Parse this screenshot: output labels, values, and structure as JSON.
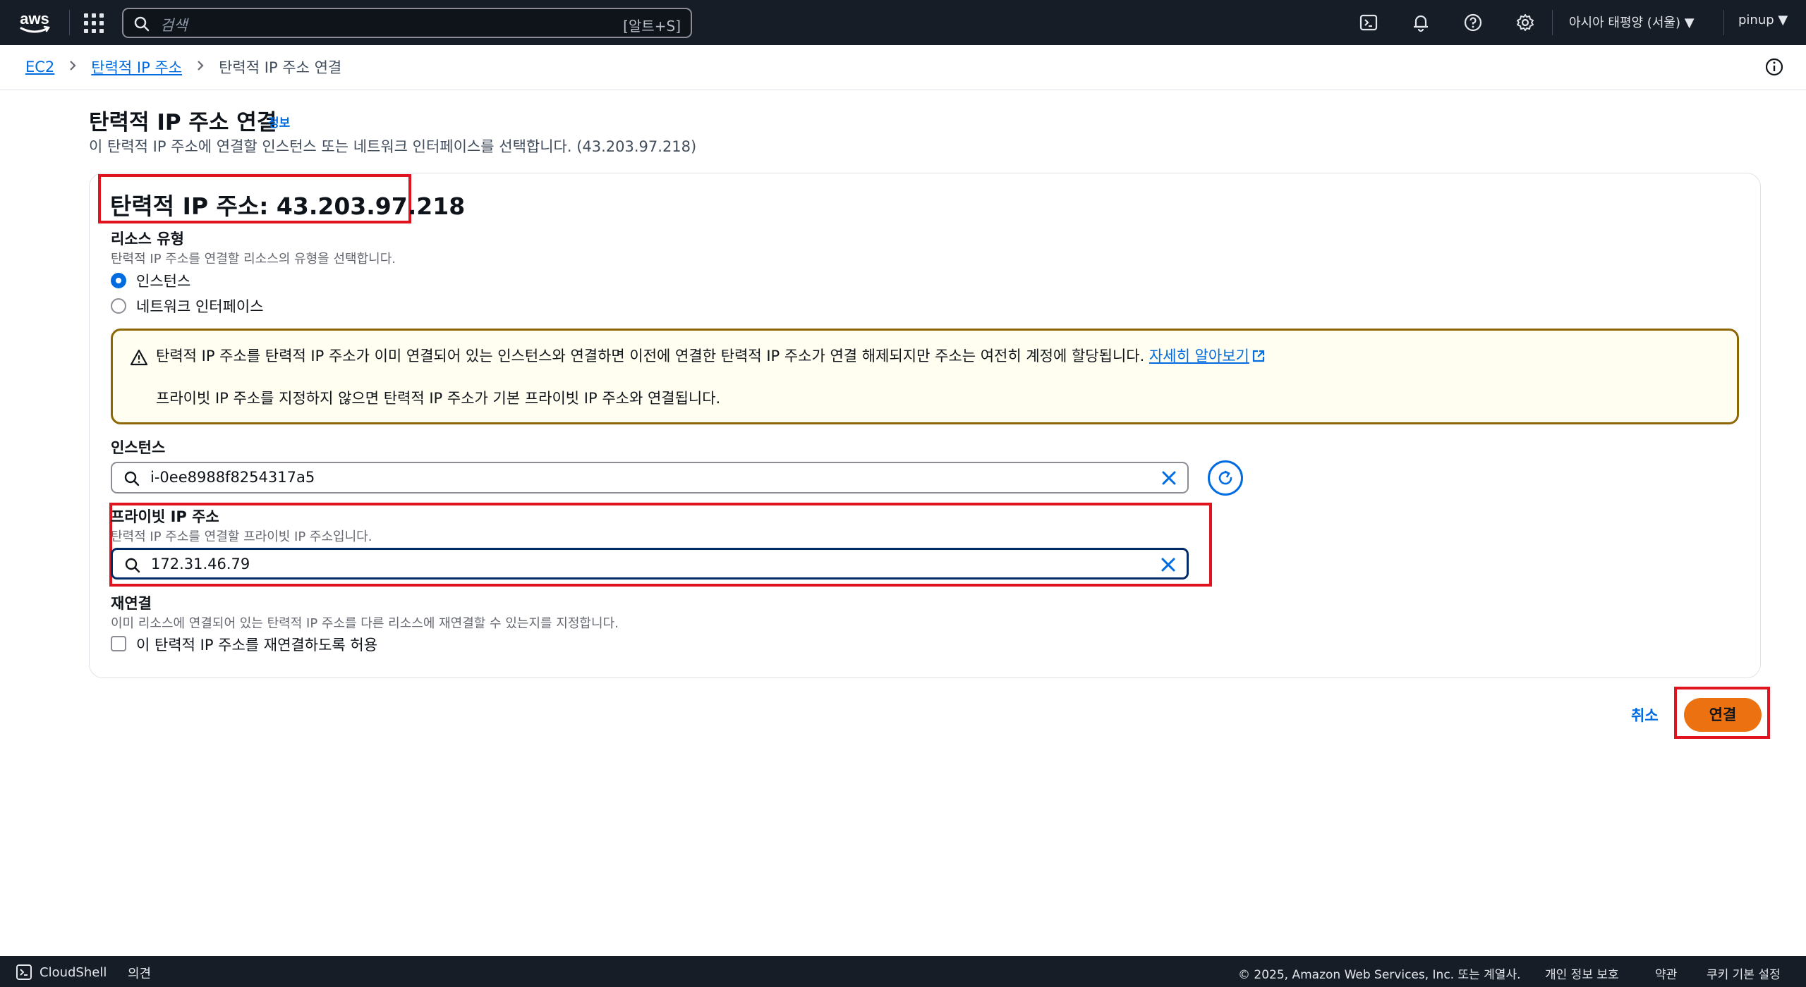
{
  "topnav": {
    "logo_text": "aws",
    "search_placeholder": "검색",
    "search_shortcut": "[알트+S]",
    "region": "아시아 태평양 (서울) ▼",
    "user": "pinup ▼"
  },
  "breadcrumb": {
    "items": [
      "EC2",
      "탄력적 IP 주소"
    ],
    "current": "탄력적 IP 주소 연결"
  },
  "page": {
    "title": "탄력적 IP 주소 연결",
    "info_link": "정보",
    "description": "이 탄력적 IP 주소에 연결할 인스턴스 또는 네트워크 인터페이스를 선택합니다. (43.203.97.218)"
  },
  "card": {
    "eip_title": "탄력적 IP 주소: 43.203.97.218",
    "resource_type": {
      "label": "리소스 유형",
      "description": "탄력적 IP 주소를 연결할 리소스의 유형을 선택합니다.",
      "options": [
        "인스턴스",
        "네트워크 인터페이스"
      ],
      "selected": "인스턴스"
    },
    "alert": {
      "line1": "탄력적 IP 주소를 탄력적 IP 주소가 이미 연결되어 있는 인스턴스와 연결하면 이전에 연결한 탄력적 IP 주소가 연결 해제되지만 주소는 여전히 계정에 할당됩니다.",
      "link": "자세히 알아보기",
      "line2": "프라이빗 IP 주소를 지정하지 않으면 탄력적 IP 주소가 기본 프라이빗 IP 주소와 연결됩니다."
    },
    "instance": {
      "label": "인스턴스",
      "value": "i-0ee8988f8254317a5"
    },
    "private_ip": {
      "label": "프라이빗 IP 주소",
      "description": "탄력적 IP 주소를 연결할 프라이빗 IP 주소입니다.",
      "value": "172.31.46.79"
    },
    "reassociation": {
      "label": "재연결",
      "description": "이미 리소스에 연결되어 있는 탄력적 IP 주소를 다른 리소스에 재연결할 수 있는지를 지정합니다.",
      "checkbox_label": "이 탄력적 IP 주소를 재연결하도록 허용"
    }
  },
  "actions": {
    "cancel": "취소",
    "associate": "연결"
  },
  "footer": {
    "cloudshell": "CloudShell",
    "feedback": "의견",
    "copyright": "© 2025, Amazon Web Services, Inc. 또는 계열사.",
    "links": [
      "개인 정보 보호",
      "약관",
      "쿠키 기본 설정"
    ]
  },
  "colors": {
    "nav_bg": "#161d26",
    "link": "#006ce0",
    "primary_button": "#ec7211",
    "highlight_box": "#e0141e",
    "alert_border": "#8d6605"
  }
}
